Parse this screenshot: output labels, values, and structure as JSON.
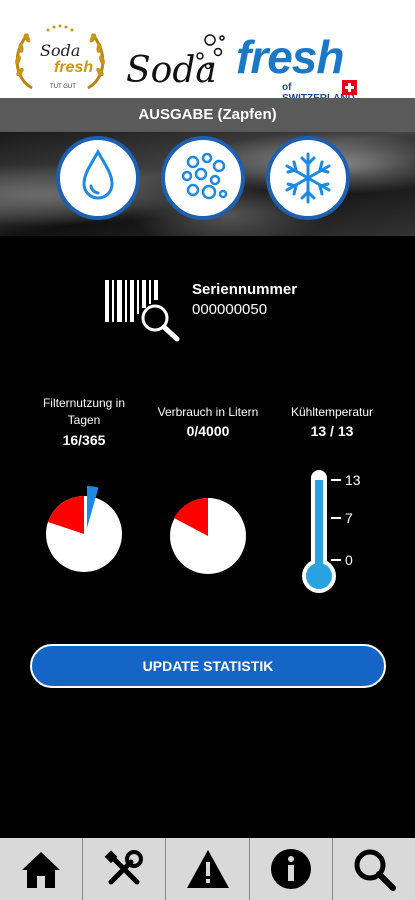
{
  "header": {
    "logo_left_line1": "Soda",
    "logo_left_line2": "fresh",
    "logo_left_line3": "TUT GUT",
    "logo_middle": "Soda",
    "logo_right_word": "fresh",
    "logo_right_sub": "of SWITZERLAND"
  },
  "title": "AUSGABE (Zapfen)",
  "modes": [
    {
      "icon": "water-drop-icon"
    },
    {
      "icon": "bubbles-icon"
    },
    {
      "icon": "snowflake-icon"
    }
  ],
  "serial": {
    "label": "Seriennummer",
    "value": "000000050",
    "icon": "barcode-search-icon"
  },
  "stats": {
    "filter": {
      "label": "Filternutzung in Tagen",
      "value": "16/365",
      "fraction": 0.044
    },
    "consumption": {
      "label": "Verbrauch in Litern",
      "value": "0/4000",
      "fraction": 0.0
    },
    "temperature": {
      "label": "Kühltemperatur",
      "value": "13 / 13",
      "ticks": [
        "13",
        "7",
        "0"
      ],
      "level": 13,
      "max": 13
    }
  },
  "update_button": "UPDATE STATISTIK",
  "bottom_nav": [
    {
      "icon": "home-icon"
    },
    {
      "icon": "tools-icon"
    },
    {
      "icon": "warning-icon"
    },
    {
      "icon": "info-icon"
    },
    {
      "icon": "search-icon"
    }
  ],
  "colors": {
    "accent": "#1565c7",
    "pie_red": "#ff0000",
    "pie_blue": "#1e88e5",
    "thermo_blue": "#29a3e0"
  }
}
